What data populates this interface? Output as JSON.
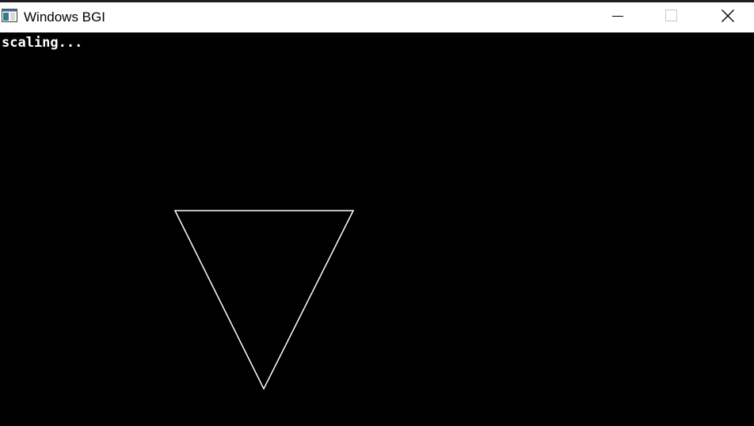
{
  "window": {
    "title": "Windows BGI",
    "controls": {
      "minimize_icon": "minimize-icon",
      "maximize_icon": "maximize-icon",
      "close_icon": "close-icon"
    }
  },
  "canvas": {
    "status_text": "scaling...",
    "background_color": "#000000",
    "shape_color": "#ffffff",
    "shape": "triangle"
  }
}
